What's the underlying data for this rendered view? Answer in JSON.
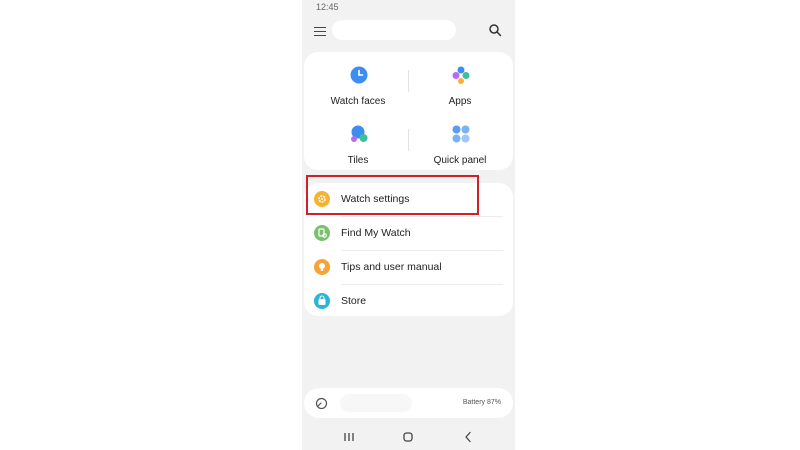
{
  "status_bar": {
    "time": "12:45"
  },
  "grid": [
    {
      "label": "Watch faces",
      "icon": "watch-faces-icon"
    },
    {
      "label": "Apps",
      "icon": "apps-icon"
    },
    {
      "label": "Tiles",
      "icon": "tiles-icon"
    },
    {
      "label": "Quick panel",
      "icon": "quick-panel-icon"
    }
  ],
  "menu": [
    {
      "label": "Watch settings",
      "icon": "gear-icon",
      "color": "#f7b234"
    },
    {
      "label": "Find My Watch",
      "icon": "find-watch-icon",
      "color": "#7cbf6e"
    },
    {
      "label": "Tips and user manual",
      "icon": "bulb-icon",
      "color": "#f6a43a"
    },
    {
      "label": "Store",
      "icon": "bag-icon",
      "color": "#28b5d6"
    }
  ],
  "footer": {
    "battery": "Battery 87%"
  },
  "colors": {
    "accent_blue": "#3d8ef0",
    "highlight_red": "#d0202a"
  }
}
